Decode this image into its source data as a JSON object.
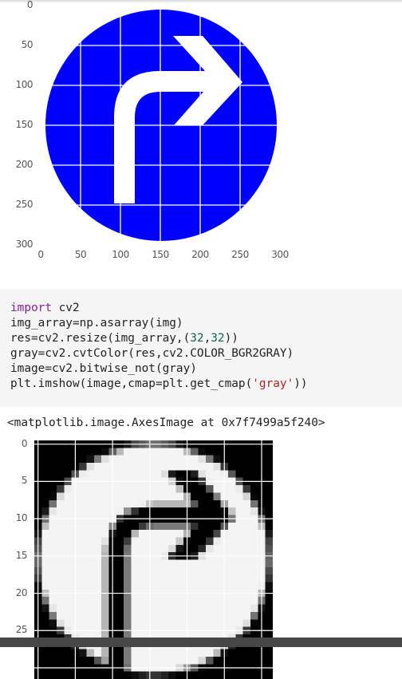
{
  "plot1": {
    "colors": {
      "sign": "#0000ff",
      "arrow": "#ffffff",
      "grid": "#ffffff"
    },
    "x_ticks": [
      "0",
      "50",
      "100",
      "150",
      "200",
      "250",
      "300"
    ],
    "y_ticks": [
      "0",
      "50",
      "100",
      "150",
      "200",
      "250",
      "300"
    ]
  },
  "code_cell": {
    "lines": [
      {
        "parts": [
          {
            "t": "import",
            "c": "kw"
          },
          {
            "t": " cv2",
            "c": ""
          }
        ]
      },
      {
        "parts": [
          {
            "t": "img_array=np.asarray(img)",
            "c": ""
          }
        ]
      },
      {
        "parts": [
          {
            "t": "res=cv2.resize(img_array,(",
            "c": ""
          },
          {
            "t": "32",
            "c": "num"
          },
          {
            "t": ",",
            "c": ""
          },
          {
            "t": "32",
            "c": "num"
          },
          {
            "t": "))",
            "c": ""
          }
        ]
      },
      {
        "parts": [
          {
            "t": "gray=cv2.cvtColor(res,cv2.COLOR_BGR2GRAY)",
            "c": ""
          }
        ]
      },
      {
        "parts": [
          {
            "t": "image=cv2.bitwise_not(gray)",
            "c": ""
          }
        ]
      },
      {
        "parts": [
          {
            "t": "plt.imshow(image,cmap=plt.get_cmap(",
            "c": ""
          },
          {
            "t": "'gray'",
            "c": "str"
          },
          {
            "t": "))",
            "c": ""
          }
        ]
      }
    ]
  },
  "output": {
    "text": "<matplotlib.image.AxesImage at 0x7f7499a5f240>"
  },
  "plot2": {
    "colors": {
      "background": "#000000",
      "sign": "#f4f4f4"
    },
    "y_ticks": [
      "0",
      "5",
      "10",
      "15",
      "20",
      "25"
    ]
  }
}
